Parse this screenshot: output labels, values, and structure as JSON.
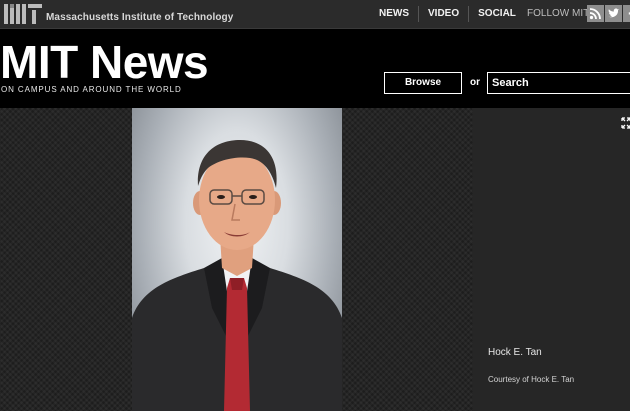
{
  "topbar": {
    "org_name": "Massachusetts Institute of Technology",
    "nav": [
      {
        "label": "NEWS"
      },
      {
        "label": "VIDEO"
      },
      {
        "label": "SOCIAL"
      }
    ],
    "follow_label": "FOLLOW MIT",
    "social_icons": [
      "rss-icon",
      "twitter-icon",
      "facebook-icon"
    ]
  },
  "header": {
    "title": "MIT News",
    "tagline": "ON CAMPUS AND AROUND THE WORLD",
    "browse_label": "Browse",
    "or_label": "or",
    "search_placeholder": "Search"
  },
  "gallery": {
    "caption_name": "Hock E. Tan",
    "caption_credit": "Courtesy of Hock E. Tan"
  },
  "colors": {
    "topbar_bg": "#2b2b2b",
    "header_bg": "#000000",
    "caption_bg": "#262626",
    "text": "#ffffff"
  }
}
